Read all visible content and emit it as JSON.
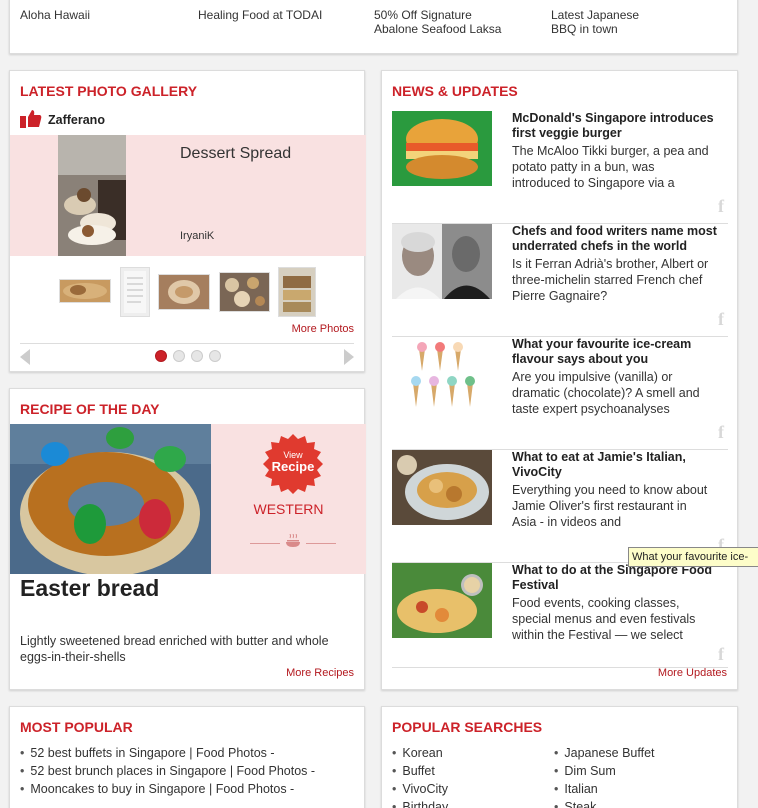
{
  "top_strip": {
    "items": [
      {
        "title": "Aloha Hawaii"
      },
      {
        "title": "Healing Food at TODAI"
      },
      {
        "title": "50% Off Signature Abalone Seafood Laksa"
      },
      {
        "title": "Latest Japanese BBQ in town"
      }
    ]
  },
  "gallery": {
    "title": "LATEST PHOTO GALLERY",
    "venue": "Zafferano",
    "photo_title": "Dessert Spread",
    "author": "IryaniK",
    "more_label": "More Photos",
    "pages": 4,
    "active_page": 1
  },
  "recipe": {
    "title": "RECIPE OF THE DAY",
    "badge_top": "View",
    "badge_main": "Recipe",
    "cuisine": "WESTERN",
    "dish": "Easter bread",
    "description": "Lightly sweetened bread enriched with butter and whole eggs-in-their-shells",
    "more_label": "More Recipes"
  },
  "news": {
    "title": "NEWS & UPDATES",
    "items": [
      {
        "headline": "McDonald's Singapore introduces first veggie burger",
        "desc": "The McAloo Tikki burger, a pea and potato patty in a bun, was introduced to Singapore via a"
      },
      {
        "headline": "Chefs and food writers name most underrated chefs in the world",
        "desc": "Is it Ferran Adrià's brother, Albert or three-michelin starred French chef Pierre Gagnaire?"
      },
      {
        "headline": "What your favourite ice-cream flavour says about you",
        "desc": "Are you impulsive (vanilla) or dramatic (chocolate)? A smell and taste expert psychoanalyses"
      },
      {
        "headline": "What to eat at Jamie's Italian, VivoCity",
        "desc": "Everything you need to know about Jamie Oliver's first restaurant in Asia - in videos and"
      },
      {
        "headline": "What to do at the Singapore Food Festival",
        "desc": "Food events, cooking classes, special menus and even festivals within the Festival — we select"
      }
    ],
    "more_label": "More Updates",
    "fb_glyph": "f"
  },
  "tooltip": "What your favourite ice-",
  "popular": {
    "title": "MOST POPULAR",
    "items": [
      "52 best buffets in Singapore | Food Photos -",
      "52 best brunch places in Singapore | Food Photos -",
      "Mooncakes to buy in Singapore | Food Photos -"
    ]
  },
  "searches": {
    "title": "POPULAR SEARCHES",
    "col1": [
      "Korean",
      "Buffet",
      "VivoCity",
      "Birthday"
    ],
    "col2": [
      "Japanese Buffet",
      "Dim Sum",
      "Italian",
      "Steak"
    ]
  },
  "colors": {
    "accent": "#cc2229",
    "band": "#f9e1e1"
  }
}
